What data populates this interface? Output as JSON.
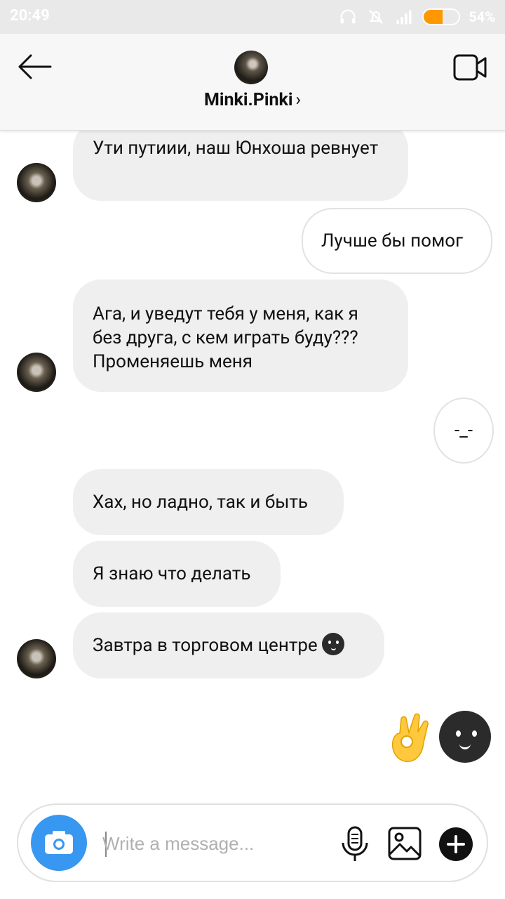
{
  "status_bar": {
    "time": "20:49",
    "battery_percent": "54%",
    "battery_level": 0.54,
    "accent_color": "#ff9800"
  },
  "header": {
    "username": "Minki.Pinki",
    "chevron": "›",
    "icons": [
      "back-arrow-icon",
      "video-call-icon"
    ]
  },
  "messages": [
    {
      "from": "them",
      "text": "Ути путиии, наш Юнхоша ревнует"
    },
    {
      "from": "me",
      "text": "Лучше бы помог"
    },
    {
      "from": "them",
      "text": "Ага, и уведут тебя у меня, как я без друга, с кем играть буду??? Променяешь меня"
    },
    {
      "from": "me",
      "text": "-_-"
    },
    {
      "from": "them",
      "text": "Хах, но ладно, так и быть"
    },
    {
      "from": "them",
      "text": "Я знаю что делать"
    },
    {
      "from": "them",
      "text": "Завтра в торговом центре",
      "emoji": "smirk-face-icon"
    },
    {
      "from": "me",
      "emojis": [
        "ok-hand-icon",
        "smirk-face-icon"
      ]
    }
  ],
  "composer": {
    "placeholder": "Write a message...",
    "value": "",
    "icons": [
      "camera-icon",
      "microphone-icon",
      "gallery-icon",
      "plus-icon"
    ],
    "camera_color": "#3897f0"
  }
}
